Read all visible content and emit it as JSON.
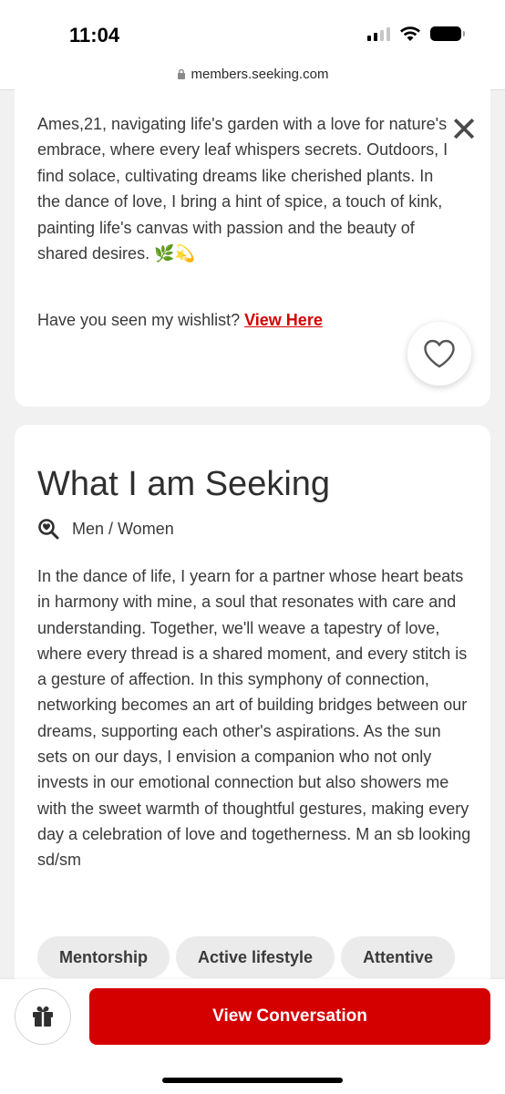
{
  "status_bar": {
    "time": "11:04",
    "icons": [
      "signal-icon",
      "wifi-icon",
      "battery-icon"
    ]
  },
  "browser": {
    "url": "members.seeking.com"
  },
  "about": {
    "text": "Ames,21, navigating life's garden with a love for nature's embrace, where every leaf whispers secrets. Outdoors, I find solace, cultivating dreams like cherished plants. In the dance of love, I bring a hint of spice, a touch of kink, painting life's canvas with passion and the beauty of shared desires. 🌿💫",
    "close_label": "✕",
    "wishlist_prefix": "Have you seen my wishlist?",
    "wishlist_link": "View Here"
  },
  "seeking": {
    "title": "What I am Seeking",
    "gender": "Men / Women",
    "text": "In the dance of life, I yearn for a partner whose heart beats in harmony with mine, a soul that resonates with care and understanding. Together, we'll weave a tapestry of love, where every thread is a shared moment, and every stitch is a gesture of affection. In this symphony of connection, networking becomes an art of building bridges between our dreams, supporting each other's aspirations. As the sun sets on our days, I envision a companion who not only invests in our emotional connection but also showers me with the sweet warmth of thoughtful gestures, making every day a celebration of love and togetherness. M an sb looking sd/sm",
    "tags": [
      "Mentorship",
      "Active lifestyle",
      "Attentive"
    ]
  },
  "actions": {
    "view_conversation": "View Conversation"
  },
  "colors": {
    "accent": "#d40000",
    "page_bg": "#f1f1f2",
    "chip_bg": "#ebebec"
  }
}
